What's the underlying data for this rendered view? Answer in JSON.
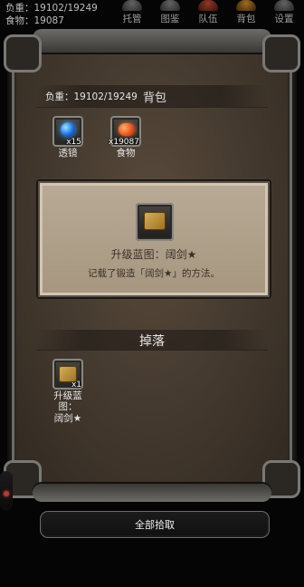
{
  "status": {
    "weight": "负重：19102/19249",
    "food": "食物：19087"
  },
  "top_nav": [
    {
      "label": "托管",
      "icon": "auto-icon"
    },
    {
      "label": "图鉴",
      "icon": "book-icon"
    },
    {
      "label": "队伍",
      "icon": "team-icon"
    },
    {
      "label": "背包",
      "icon": "bag-icon"
    },
    {
      "label": "设置",
      "icon": "settings-icon"
    }
  ],
  "bag": {
    "weight": "负重：19102/19249",
    "title": "背包",
    "items": [
      {
        "name": "透镜",
        "count": "x15",
        "icon": "lens-orb-icon"
      },
      {
        "name": "食物",
        "count": "x19087",
        "icon": "food-icon"
      }
    ]
  },
  "selected_item": {
    "title": "升级蓝图：阔剑★",
    "desc": "记载了锻造「阔剑★」的方法。",
    "icon": "scroll-icon"
  },
  "loot": {
    "title": "掉落",
    "items": [
      {
        "name_line1": "升级蓝图：",
        "name_line2": "阔剑★",
        "count": "x1",
        "icon": "scroll-icon"
      }
    ]
  },
  "actions": {
    "collect_all": "全部拾取"
  }
}
